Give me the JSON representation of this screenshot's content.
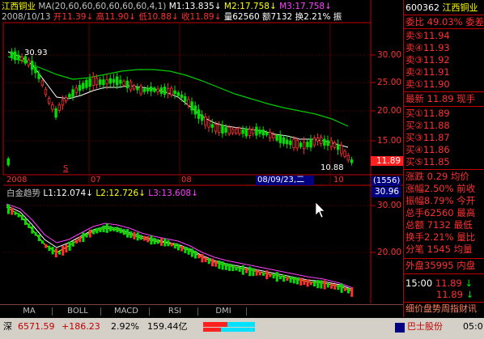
{
  "header": {
    "stock_name": "江西铜业",
    "ma_params": "MA(20,60,60,60,60,60,60,4,1)",
    "m1": "M1:13.835",
    "m2": "M2:17.758",
    "m3": "M3:17.758",
    "date": "2008/10/13",
    "open": "开11.39",
    "high": "高11.90",
    "low": "低10.88",
    "close": "收11.89",
    "volume": "量62560",
    "amount": "额7132",
    "turnover": "换2.21%",
    "amp": "振"
  },
  "price_axis": {
    "labels": [
      "30.00",
      "25.00",
      "20.00",
      "15.00"
    ],
    "current_price_tag": "11.89",
    "high_marker": "30.93",
    "low_marker": "10.88",
    "s_marker": "S"
  },
  "date_axis": {
    "labels": [
      "2008",
      "07",
      "08",
      "10"
    ],
    "cursor_date": "08/09/23,二"
  },
  "indicator": {
    "name": "白金趋势",
    "l1": "L1:12.074",
    "l2": "L2:12.726",
    "l3": "L3:13.608",
    "vol_tag": "(1556)",
    "value_tag": "30.96",
    "axis_labels": [
      "30.00",
      "20.00"
    ]
  },
  "tabs": [
    "MA",
    "BOLL",
    "MACD",
    "RSI",
    "DMI"
  ],
  "right_panel": {
    "code": "600362",
    "name": "江西铜业",
    "weibi_label": "委比",
    "weibi_value": "49.03%",
    "weicha_label": "委差",
    "sell": [
      {
        "label": "卖⑤",
        "price": "11.94"
      },
      {
        "label": "卖④",
        "price": "11.93"
      },
      {
        "label": "卖③",
        "price": "11.92"
      },
      {
        "label": "卖②",
        "price": "11.91"
      },
      {
        "label": "卖①",
        "price": "11.90"
      }
    ],
    "latest_label": "最新",
    "latest_price": "11.89",
    "latest_suffix": "现手",
    "buy": [
      {
        "label": "买①",
        "price": "11.89"
      },
      {
        "label": "买②",
        "price": "11.88"
      },
      {
        "label": "买③",
        "price": "11.87"
      },
      {
        "label": "买④",
        "price": "11.86"
      },
      {
        "label": "买⑤",
        "price": "11.85"
      }
    ],
    "stats": [
      {
        "label": "涨跌",
        "value": "0.29",
        "suffix": "均价"
      },
      {
        "label": "涨幅",
        "value": "2.50%",
        "suffix": "前收"
      },
      {
        "label": "振幅",
        "value": "8.79%",
        "suffix": "今开"
      },
      {
        "label": "总手",
        "value": "62560",
        "suffix": "最高"
      },
      {
        "label": "总额",
        "value": "7132",
        "suffix": "最低"
      },
      {
        "label": "换手",
        "value": "2.21%",
        "suffix": "量比"
      },
      {
        "label": "分笔",
        "value": "1545",
        "suffix": "均量"
      }
    ],
    "outer_label": "外盘",
    "outer_value": "35995",
    "inner_label": "内盘",
    "tick_time": "15:00",
    "tick_price": "11.89",
    "tick_arrow": "↓",
    "tick2_price": "11.89",
    "tick2_arrow": "↓",
    "bottom_tabs": "细价盘势周指财讯"
  },
  "status_bar": {
    "index_name": "深",
    "index_value": "6571.59",
    "index_change": "+186.23",
    "index_pct": "2.92%",
    "index_amount": "159.44亿",
    "broker": "巴士股份",
    "time": "05:0"
  },
  "colors": {
    "up": "#ff3030",
    "down": "#00e000",
    "ma1": "#ffffff",
    "ma2": "#00cc00",
    "l3": "#ff40ff"
  }
}
